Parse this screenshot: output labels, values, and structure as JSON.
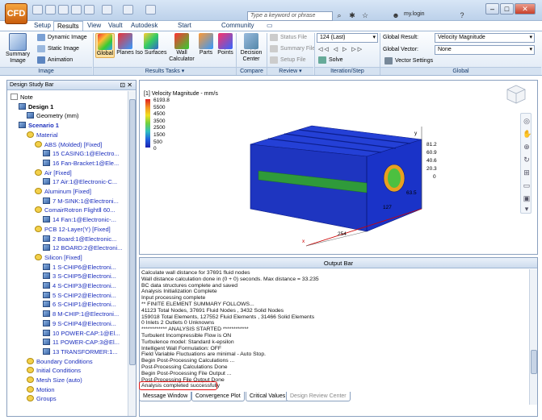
{
  "app": {
    "logo_text": "CFD",
    "search_placeholder": "Type a keyword or phrase",
    "login_label": "my.login",
    "title_help": "?"
  },
  "tabs": [
    "Setup",
    "Results",
    "View",
    "Vault",
    "Autodesk 360",
    "Start & Learn",
    "Community"
  ],
  "ribbon": {
    "image_group": {
      "label": "Image",
      "summary": "Summary Image",
      "dynamic": "Dynamic Image",
      "static": "Static Image",
      "animation": "Animation"
    },
    "results_tasks": {
      "label": "Results Tasks",
      "global": "Global",
      "planes": "Planes",
      "iso": "Iso Surfaces",
      "wall": "Wall Calculator",
      "parts": "Parts",
      "points": "Points"
    },
    "compare": {
      "label": "Compare",
      "decision": "Decision Center"
    },
    "review": {
      "label": "Review",
      "status": "Status File",
      "summary": "Summary File",
      "setup": "Setup File"
    },
    "iteration": {
      "label": "Iteration/Step",
      "value": "124 (Last)",
      "solve": "Solve"
    },
    "global_group": {
      "label": "Global",
      "result_label": "Global Result:",
      "result_value": "Velocity Magnitude",
      "vector_label": "Global Vector:",
      "vector_value": "None",
      "vector_settings": "Vector Settings"
    }
  },
  "design_study": {
    "title": "Design Study Bar",
    "items": [
      {
        "text": "Note",
        "indent": 0,
        "icon": "doc",
        "blue": false,
        "bold": false
      },
      {
        "text": "Design 1",
        "indent": 1,
        "icon": "part",
        "blue": false,
        "bold": true
      },
      {
        "text": "Geometry (mm)",
        "indent": 2,
        "icon": "part",
        "blue": false,
        "bold": false
      },
      {
        "text": "Scenario 1",
        "indent": 1,
        "icon": "part",
        "blue": true,
        "bold": true
      },
      {
        "text": "Material",
        "indent": 2,
        "icon": "mat",
        "blue": true,
        "bold": false
      },
      {
        "text": "ABS (Molded) [Fixed]",
        "indent": 3,
        "icon": "mat",
        "blue": true,
        "bold": false
      },
      {
        "text": "15 CASING:1@Electro...",
        "indent": 4,
        "icon": "part",
        "blue": true,
        "bold": false
      },
      {
        "text": "16 Fan-Bracket:1@Ele...",
        "indent": 4,
        "icon": "part",
        "blue": true,
        "bold": false
      },
      {
        "text": "Air [Fixed]",
        "indent": 3,
        "icon": "mat",
        "blue": true,
        "bold": false
      },
      {
        "text": "17 Air:1@Electronic-C...",
        "indent": 4,
        "icon": "part",
        "blue": true,
        "bold": false
      },
      {
        "text": "Aluminum [Fixed]",
        "indent": 3,
        "icon": "mat",
        "blue": true,
        "bold": false
      },
      {
        "text": "7 M-SINK:1@Electroni...",
        "indent": 4,
        "icon": "part",
        "blue": true,
        "bold": false
      },
      {
        "text": "ComairRotron FlightⅡ 60...",
        "indent": 3,
        "icon": "mat",
        "blue": true,
        "bold": false
      },
      {
        "text": "14 Fan:1@Electronic-...",
        "indent": 4,
        "icon": "part",
        "blue": true,
        "bold": false
      },
      {
        "text": "PCB 12-Layer(Y) [Fixed]",
        "indent": 3,
        "icon": "mat",
        "blue": true,
        "bold": false
      },
      {
        "text": "2 Board:1@Electronic...",
        "indent": 4,
        "icon": "part",
        "blue": true,
        "bold": false
      },
      {
        "text": "12 BOARD:2@Electroni...",
        "indent": 4,
        "icon": "part",
        "blue": true,
        "bold": false
      },
      {
        "text": "Silicon [Fixed]",
        "indent": 3,
        "icon": "mat",
        "blue": true,
        "bold": false
      },
      {
        "text": "1 S-CHIP6@Electroni...",
        "indent": 4,
        "icon": "part",
        "blue": true,
        "bold": false
      },
      {
        "text": "3 S-CHIP5@Electroni...",
        "indent": 4,
        "icon": "part",
        "blue": true,
        "bold": false
      },
      {
        "text": "4 S-CHIP3@Electroni...",
        "indent": 4,
        "icon": "part",
        "blue": true,
        "bold": false
      },
      {
        "text": "5 S-CHIP2@Electroni...",
        "indent": 4,
        "icon": "part",
        "blue": true,
        "bold": false
      },
      {
        "text": "6 S-CHIP1@Electroni...",
        "indent": 4,
        "icon": "part",
        "blue": true,
        "bold": false
      },
      {
        "text": "8 M-CHIP:1@Electroni...",
        "indent": 4,
        "icon": "part",
        "blue": true,
        "bold": false
      },
      {
        "text": "9 S-CHIP4@Electroni...",
        "indent": 4,
        "icon": "part",
        "blue": true,
        "bold": false
      },
      {
        "text": "10 POWER-CAP:1@El...",
        "indent": 4,
        "icon": "part",
        "blue": true,
        "bold": false
      },
      {
        "text": "11 POWER-CAP:3@El...",
        "indent": 4,
        "icon": "part",
        "blue": true,
        "bold": false
      },
      {
        "text": "13 TRANSFORMER:1...",
        "indent": 4,
        "icon": "part",
        "blue": true,
        "bold": false
      },
      {
        "text": "Boundary Conditions",
        "indent": 2,
        "icon": "mat",
        "blue": true,
        "bold": false
      },
      {
        "text": "Initial Conditions",
        "indent": 2,
        "icon": "mat",
        "blue": true,
        "bold": false
      },
      {
        "text": "Mesh Size (auto)",
        "indent": 2,
        "icon": "mat",
        "blue": true,
        "bold": false
      },
      {
        "text": "Motion",
        "indent": 2,
        "icon": "mat",
        "blue": true,
        "bold": false
      },
      {
        "text": "Groups",
        "indent": 2,
        "icon": "mat",
        "blue": true,
        "bold": false
      }
    ]
  },
  "legend": {
    "title": "[1] Velocity Magnitude - mm/s",
    "values": [
      "6193.8",
      "5500",
      "4500",
      "3500",
      "2500",
      "1500",
      "500",
      "0"
    ]
  },
  "model": {
    "dim_x": "254",
    "dim_y_axis": [
      "81.2",
      "60.9",
      "40.6",
      "20.3",
      "0"
    ],
    "dim_depth": "63.5",
    "dim_width": "127",
    "axis_x": "x",
    "axis_y": "y"
  },
  "output": {
    "title": "Output Bar",
    "lines": [
      "Calculate wall distance for 37691 fluid nodes",
      "Wall distance calculation done in (0 + 0) seconds. Max distance = 33.235",
      "BC data structures complete and saved",
      "Analysis Initialization Complete",
      "Input processing complete",
      "** FINITE ELEMENT SUMMARY FOLLOWS...",
      "  41123 Total Nodes,   37691 Fluid Nodes ,   3432 Solid Nodes",
      "  159018 Total Elements,   127552 Fluid Elements ,   31466 Solid Elements",
      "  0 Inlets   2 Outlets   0 Unknowns",
      "************ ANALYSIS STARTED ************",
      "Turbulent Incompressible Flow is ON",
      "Turbulence model: Standard k-epsilon",
      "Intelligent Wall Formulation: OFF",
      "Field Variable Fluctuations are minimal - Auto Stop.",
      "Begin Post-Processing Calculations ...",
      "Post-Processing Calculations Done",
      "Begin Post-Processing File Output ...",
      "Post-Processing File Output Done",
      "Analysis completed successfully"
    ],
    "tabs": [
      "Message Window",
      "Convergence Plot",
      "Critical Values",
      "Design Review Center"
    ]
  }
}
